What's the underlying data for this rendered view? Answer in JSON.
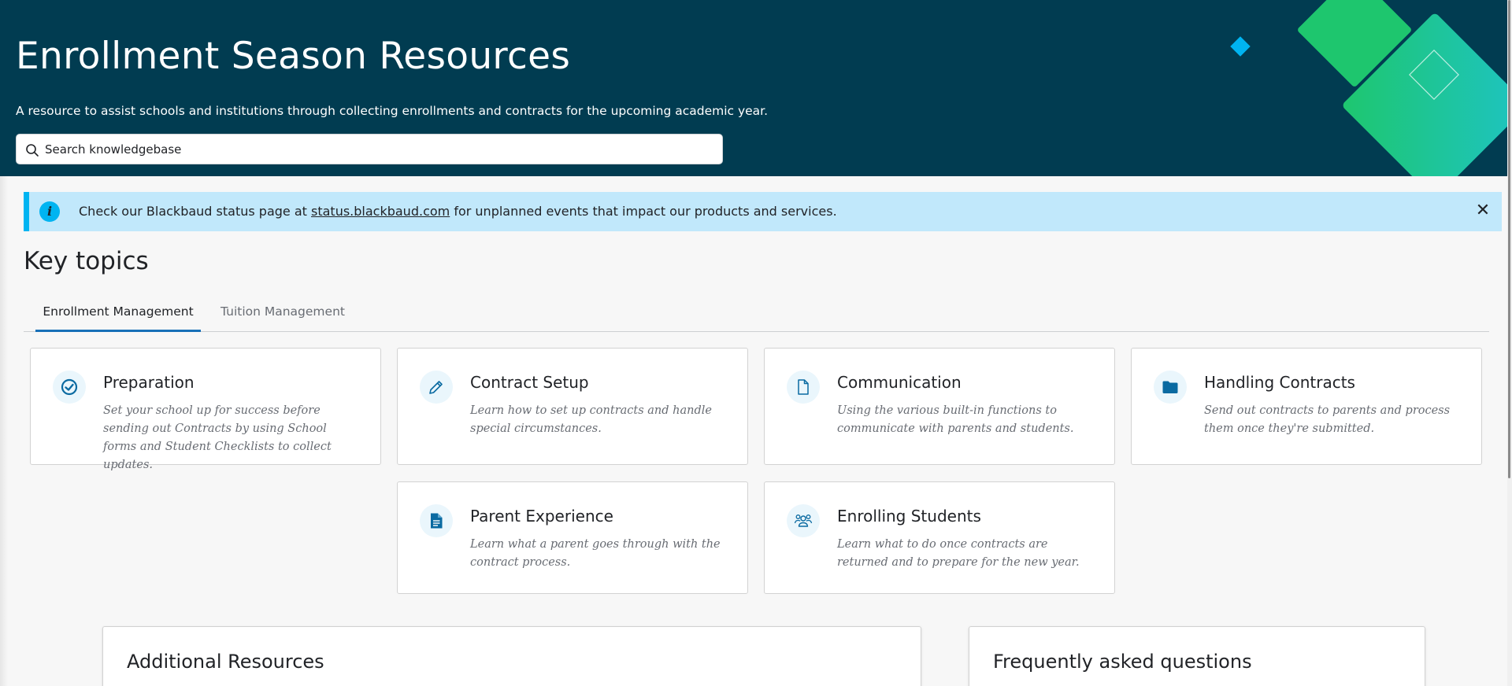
{
  "header": {
    "title": "Enrollment Season Resources",
    "subtitle": "A resource to assist schools and institutions through collecting enrollments and contracts for the upcoming academic year.",
    "search_placeholder": "Search knowledgebase",
    "background_color": "#013c51"
  },
  "alert": {
    "text_before": "Check our Blackbaud status page at ",
    "link_text": "status.blackbaud.com",
    "text_after": " for unplanned events that impact our products and services.",
    "info_glyph": "i",
    "close_glyph": "✕",
    "background_color": "#c1e8fb",
    "accent_color": "#00b4f1"
  },
  "key_topics": {
    "title": "Key topics",
    "tabs": [
      {
        "label": "Enrollment Management",
        "active": true
      },
      {
        "label": "Tuition Management",
        "active": false
      }
    ],
    "cards": [
      {
        "title": "Preparation",
        "description": "Set your school up for success before sending out Contracts by using School forms and Student Checklists to collect updates.",
        "icon": "check-circle-icon"
      },
      {
        "title": "Contract Setup",
        "description": "Learn how to set up contracts and handle special circumstances.",
        "icon": "pencil-icon"
      },
      {
        "title": "Communication",
        "description": "Using the various built-in functions to communicate with parents and students.",
        "icon": "document-icon"
      },
      {
        "title": "Handling Contracts",
        "description": "Send out contracts to parents and process them once they're submitted.",
        "icon": "folder-icon"
      },
      {
        "title": "Parent Experience",
        "description": "Learn what a parent goes through with the contract process.",
        "icon": "file-text-icon"
      },
      {
        "title": "Enrolling Students",
        "description": "Learn what to do once contracts are returned and to prepare for the new year.",
        "icon": "people-icon"
      }
    ]
  },
  "panels": {
    "additional_resources_title": "Additional Resources",
    "faq_title": "Frequently asked questions"
  },
  "colors": {
    "accent_blue": "#1870b8",
    "icon_blue": "#0a6aa1",
    "deco_green": "#1ec66e",
    "deco_teal": "#1ec4c4",
    "deco_cyan": "#00b4f1"
  }
}
